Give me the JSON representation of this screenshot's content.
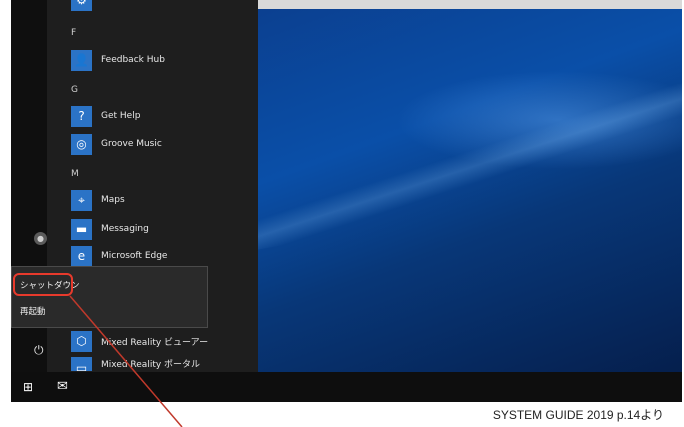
{
  "start_menu": {
    "letters": [
      "F",
      "G",
      "M"
    ],
    "apps": [
      {
        "label": "Feedback Hub",
        "icon": "feedback-hub-icon"
      },
      {
        "label": "Get Help",
        "icon": "get-help-icon"
      },
      {
        "label": "Groove Music",
        "icon": "groove-music-icon"
      },
      {
        "label": "Maps",
        "icon": "maps-icon"
      },
      {
        "label": "Messaging",
        "icon": "messaging-icon"
      },
      {
        "label": "Microsoft Edge",
        "icon": "edge-icon"
      },
      {
        "label": "Mixed Reality ビューアー",
        "icon": "mixed-reality-viewer-icon"
      },
      {
        "label": "Mixed Reality ポータル",
        "icon": "mixed-reality-portal-icon"
      }
    ]
  },
  "power_menu": {
    "shutdown_label": "シャットダウン",
    "restart_label": "再起動"
  },
  "footer": {
    "credit": "SYSTEM GUIDE 2019 p.14より"
  },
  "colors": {
    "tile": "#2b73c6",
    "highlight": "#e83a2c"
  }
}
